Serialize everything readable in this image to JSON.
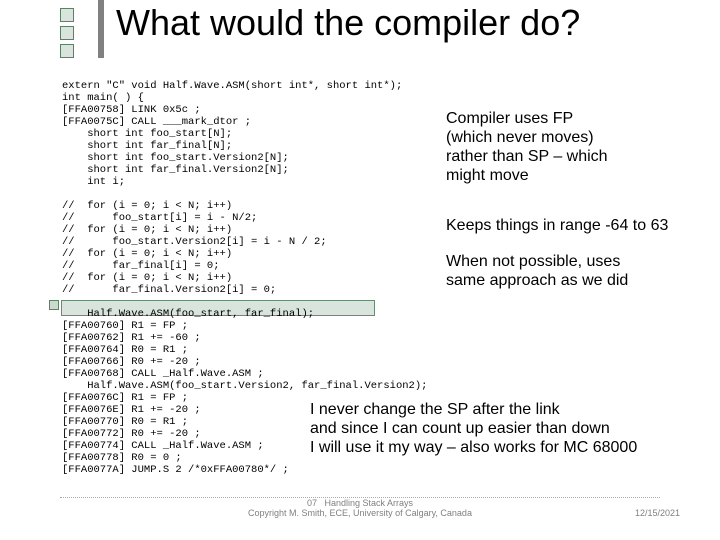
{
  "title": "What would the compiler do?",
  "code": "extern \"C\" void Half.Wave.ASM(short int*, short int*);\nint main( ) {\n[FFA00758] LINK 0x5c ;\n[FFA0075C] CALL ___mark_dtor ;\n    short int foo_start[N];\n    short int far_final[N];\n    short int foo_start.Version2[N];\n    short int far_final.Version2[N];\n    int i;\n\n//  for (i = 0; i < N; i++)\n//      foo_start[i] = i - N/2;\n//  for (i = 0; i < N; i++)\n//      foo_start.Version2[i] = i - N / 2;\n//  for (i = 0; i < N; i++)\n//      far_final[i] = 0;\n//  for (i = 0; i < N; i++)\n//      far_final.Version2[i] = 0;\n\n    Half.Wave.ASM(foo_start, far_final);\n[FFA00760] R1 = FP ;\n[FFA00762] R1 += -60 ;\n[FFA00764] R0 = R1 ;\n[FFA00766] R0 += -20 ;\n[FFA00768] CALL _Half.Wave.ASM ;\n    Half.Wave.ASM(foo_start.Version2, far_final.Version2);\n[FFA0076C] R1 = FP ;\n[FFA0076E] R1 += -20 ;\n[FFA00770] R0 = R1 ;\n[FFA00772] R0 += -20 ;\n[FFA00774] CALL _Half.Wave.ASM ;\n[FFA00778] R0 = 0 ;\n[FFA0077A] JUMP.S 2 /*0xFFA00780*/ ;",
  "annotations": {
    "a1": "Compiler uses FP\n(which never moves)\nrather than SP – which\nmight move",
    "a2": "Keeps things in range -64 to 63",
    "a3": "When not possible, uses\nsame approach as we did",
    "a4": "I never change the SP after the link\nand since I can count up easier than down\nI will use it my way – also works for MC 68000"
  },
  "footer": {
    "center": "Handling Stack Arrays\nCopyright M. Smith, ECE, University of Calgary, Canada",
    "page": "07",
    "right": "12/15/2021"
  }
}
